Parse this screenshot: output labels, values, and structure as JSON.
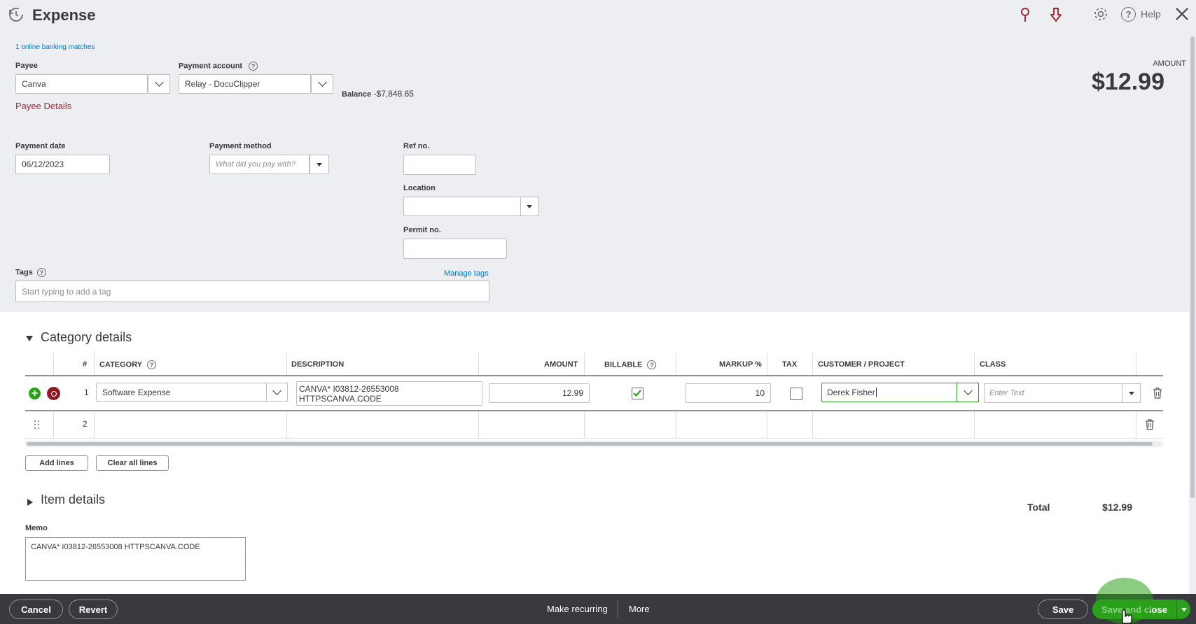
{
  "header": {
    "title": "Expense",
    "help_label": "Help"
  },
  "banking_matches": "1 online banking matches",
  "payee": {
    "label": "Payee",
    "value": "Canva",
    "details_link": "Payee Details"
  },
  "payment_account": {
    "label": "Payment account",
    "value": "Relay - DocuClipper",
    "balance_label": "Balance",
    "balance_value": "-$7,848.65"
  },
  "amount": {
    "label": "AMOUNT",
    "value": "$12.99"
  },
  "payment_date": {
    "label": "Payment date",
    "value": "06/12/2023"
  },
  "payment_method": {
    "label": "Payment method",
    "placeholder": "What did you pay with?"
  },
  "ref_no": {
    "label": "Ref no.",
    "value": ""
  },
  "location": {
    "label": "Location",
    "value": ""
  },
  "permit_no": {
    "label": "Permit no.",
    "value": ""
  },
  "tags": {
    "label": "Tags",
    "manage_link": "Manage tags",
    "placeholder": "Start typing to add a tag"
  },
  "category_details": {
    "title": "Category details",
    "columns": [
      "#",
      "CATEGORY",
      "DESCRIPTION",
      "AMOUNT",
      "BILLABLE",
      "MARKUP %",
      "TAX",
      "CUSTOMER / PROJECT",
      "CLASS"
    ],
    "rows": [
      {
        "num": "1",
        "category": "Software Expense",
        "description": "CANVA* I03812-26553008 HTTPSCANVA.CODE",
        "amount": "12.99",
        "billable": true,
        "markup": "10",
        "tax": false,
        "customer": "Derek Fisher",
        "class_placeholder": "Enter Text"
      },
      {
        "num": "2"
      }
    ],
    "add_lines": "Add lines",
    "clear_lines": "Clear all lines"
  },
  "item_details": {
    "title": "Item details"
  },
  "total": {
    "label": "Total",
    "value": "$12.99"
  },
  "memo": {
    "label": "Memo",
    "value": "CANVA* I03812-26553008 HTTPSCANVA.CODE"
  },
  "footer": {
    "cancel": "Cancel",
    "revert": "Revert",
    "make_recurring": "Make recurring",
    "more": "More",
    "save": "Save",
    "save_and_close": "Save and close"
  },
  "colors": {
    "accent_green": "#2ca01c",
    "link_blue": "#0077c5",
    "payee_link_red": "#a12b3a",
    "footer_bg": "#393a3d"
  }
}
